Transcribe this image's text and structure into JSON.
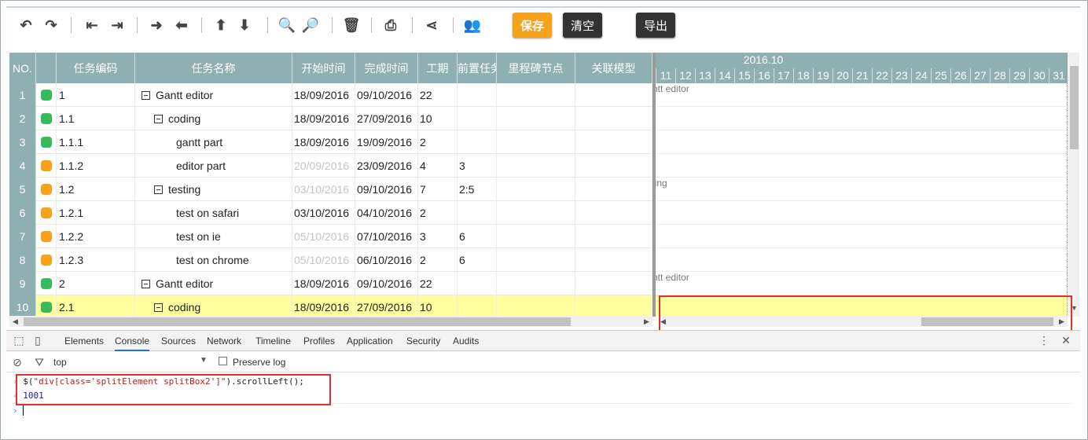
{
  "toolbar": {
    "icons": [
      "undo-icon",
      "redo-icon",
      "outdent-icon",
      "indent-icon",
      "move-right-icon",
      "move-left-icon",
      "move-up-icon",
      "move-down-icon",
      "zoom-in-icon",
      "zoom-out-icon",
      "delete-icon",
      "print-icon",
      "share-icon",
      "resources-icon"
    ],
    "save_label": "保存",
    "clear_label": "清空",
    "export_label": "导出"
  },
  "grid": {
    "headers": {
      "no": "NO.",
      "code": "任务编码",
      "name": "任务名称",
      "start": "开始时间",
      "end": "完成时间",
      "duration": "工期",
      "depends": "前置任务",
      "milestone": "里程碑节点",
      "related": "关联模型"
    },
    "rows": [
      {
        "no": "1",
        "status": "green",
        "code": "1",
        "name": "Gantt editor",
        "toggle": true,
        "indent": 0,
        "start": "18/09/2016",
        "start_gray": false,
        "end": "09/10/2016",
        "duration": "22",
        "depends": ""
      },
      {
        "no": "2",
        "status": "green",
        "code": "1.1",
        "name": "coding",
        "toggle": true,
        "indent": 1,
        "start": "18/09/2016",
        "start_gray": false,
        "end": "27/09/2016",
        "duration": "10",
        "depends": ""
      },
      {
        "no": "3",
        "status": "green",
        "code": "1.1.1",
        "name": "gantt part",
        "toggle": false,
        "indent": 2,
        "start": "18/09/2016",
        "start_gray": false,
        "end": "19/09/2016",
        "duration": "2",
        "depends": ""
      },
      {
        "no": "4",
        "status": "orange",
        "code": "1.1.2",
        "name": "editor part",
        "toggle": false,
        "indent": 2,
        "start": "20/09/2016",
        "start_gray": true,
        "end": "23/09/2016",
        "duration": "4",
        "depends": "3"
      },
      {
        "no": "5",
        "status": "orange",
        "code": "1.2",
        "name": "testing",
        "toggle": true,
        "indent": 1,
        "start": "03/10/2016",
        "start_gray": true,
        "end": "09/10/2016",
        "duration": "7",
        "depends": "2:5"
      },
      {
        "no": "6",
        "status": "orange",
        "code": "1.2.1",
        "name": "test on safari",
        "toggle": false,
        "indent": 2,
        "start": "03/10/2016",
        "start_gray": false,
        "end": "04/10/2016",
        "duration": "2",
        "depends": ""
      },
      {
        "no": "7",
        "status": "orange",
        "code": "1.2.2",
        "name": "test on ie",
        "toggle": false,
        "indent": 2,
        "start": "05/10/2016",
        "start_gray": true,
        "end": "07/10/2016",
        "duration": "3",
        "depends": "6"
      },
      {
        "no": "8",
        "status": "orange",
        "code": "1.2.3",
        "name": "test on chrome",
        "toggle": false,
        "indent": 2,
        "start": "05/10/2016",
        "start_gray": true,
        "end": "06/10/2016",
        "duration": "2",
        "depends": "6"
      },
      {
        "no": "9",
        "status": "green",
        "code": "2",
        "name": "Gantt editor",
        "toggle": true,
        "indent": 0,
        "start": "18/09/2016",
        "start_gray": false,
        "end": "09/10/2016",
        "duration": "22",
        "depends": ""
      },
      {
        "no": "10",
        "status": "green",
        "code": "2.1",
        "name": "coding",
        "toggle": true,
        "indent": 1,
        "start": "18/09/2016",
        "start_gray": false,
        "end": "27/09/2016",
        "duration": "10",
        "depends": "",
        "selected": true
      }
    ]
  },
  "gantt": {
    "month": "2016.10",
    "days": [
      "11",
      "12",
      "13",
      "14",
      "15",
      "16",
      "17",
      "18",
      "19",
      "20",
      "21",
      "22",
      "23",
      "24",
      "25",
      "26",
      "27",
      "28",
      "29",
      "30",
      "31"
    ],
    "labels": [
      "ntt editor",
      "",
      "",
      "",
      "ling",
      "",
      "",
      "",
      "ntt editor",
      ""
    ]
  },
  "devtools": {
    "tabs": [
      "Elements",
      "Console",
      "Sources",
      "Network",
      "Timeline",
      "Profiles",
      "Application",
      "Security",
      "Audits"
    ],
    "active_tab": "Console",
    "context": "top",
    "preserve_log": "Preserve log",
    "command_prefix": "$(",
    "command_string": "\"div[class='splitElement splitBox2']\"",
    "command_suffix": ").scrollLeft();",
    "result": "1001"
  },
  "colors": {
    "header": "#8fb0b2",
    "status_green": "#3ab85c",
    "status_orange": "#f7a21b",
    "selected_row": "#ffffa0",
    "highlight_box": "#e03030"
  }
}
